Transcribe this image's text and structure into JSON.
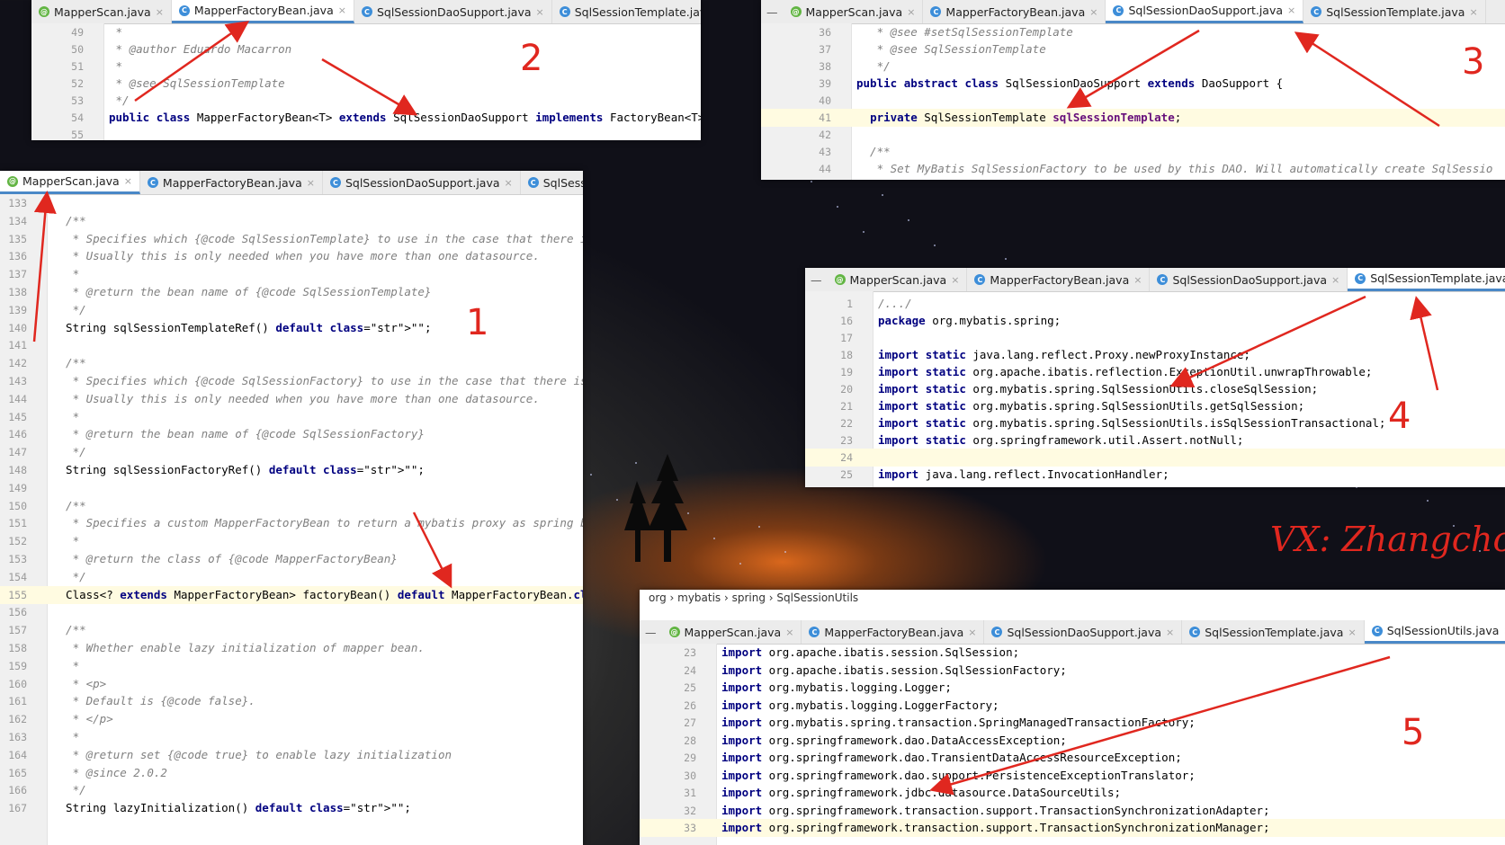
{
  "watermark": "VX:  Zhangchong",
  "colors": {
    "accent": "#4a88c7",
    "keyword": "#000080",
    "comment": "#808080",
    "arrow": "#e0271f"
  },
  "panel2": {
    "label": "2",
    "tabs": [
      {
        "name": "MapperScan.java",
        "icon": "annotation-icon"
      },
      {
        "name": "MapperFactoryBean.java",
        "icon": "class-icon",
        "active": true
      },
      {
        "name": "SqlSessionDaoSupport.java",
        "icon": "class-icon"
      },
      {
        "name": "SqlSessionTemplate.java",
        "icon": "class-icon"
      },
      {
        "name": "Sql",
        "icon": "class-icon"
      }
    ],
    "lines": [
      {
        "n": "49",
        "t": " *",
        "c": "cm"
      },
      {
        "n": "50",
        "t": " * @author Eduardo Macarron",
        "c": "cm"
      },
      {
        "n": "51",
        "t": " *",
        "c": "cm"
      },
      {
        "n": "52",
        "t": " * @see SqlSessionTemplate",
        "c": "cm"
      },
      {
        "n": "53",
        "t": " */",
        "c": "cm"
      },
      {
        "n": "54",
        "t": "public class MapperFactoryBean<T> extends SqlSessionDaoSupport implements FactoryBean<T> {",
        "c": ""
      },
      {
        "n": "55",
        "t": "",
        "c": ""
      }
    ]
  },
  "panel3": {
    "label": "3",
    "tabs": [
      {
        "name": "MapperScan.java",
        "icon": "annotation-icon"
      },
      {
        "name": "MapperFactoryBean.java",
        "icon": "class-icon"
      },
      {
        "name": "SqlSessionDaoSupport.java",
        "icon": "class-icon",
        "active": true
      },
      {
        "name": "SqlSessionTemplate.java",
        "icon": "class-icon"
      }
    ],
    "lines": [
      {
        "n": "36",
        "t": "   * @see #setSqlSessionTemplate",
        "c": "cm"
      },
      {
        "n": "37",
        "t": "   * @see SqlSessionTemplate",
        "c": "cm"
      },
      {
        "n": "38",
        "t": "   */",
        "c": "cm"
      },
      {
        "n": "39",
        "t": "public abstract class SqlSessionDaoSupport extends DaoSupport {",
        "c": ""
      },
      {
        "n": "40",
        "t": "",
        "c": ""
      },
      {
        "n": "41",
        "t": "  private SqlSessionTemplate sqlSessionTemplate;",
        "c": "",
        "hl": true
      },
      {
        "n": "42",
        "t": "",
        "c": ""
      },
      {
        "n": "43",
        "t": "  /**",
        "c": "cm"
      },
      {
        "n": "44",
        "t": "   * Set MyBatis SqlSessionFactory to be used by this DAO. Will automatically create SqlSessio",
        "c": "cm"
      }
    ]
  },
  "panel1": {
    "label": "1",
    "tabs": [
      {
        "name": "MapperScan.java",
        "icon": "annotation-icon",
        "active": true
      },
      {
        "name": "MapperFactoryBean.java",
        "icon": "class-icon"
      },
      {
        "name": "SqlSessionDaoSupport.java",
        "icon": "class-icon"
      },
      {
        "name": "SqlSessionTem",
        "icon": "class-icon"
      }
    ],
    "lines": [
      {
        "n": "133",
        "t": "",
        "c": ""
      },
      {
        "n": "134",
        "t": "  /**",
        "c": "cm"
      },
      {
        "n": "135",
        "t": "   * Specifies which {@code SqlSessionTemplate} to use in the case that there is more",
        "c": "cm"
      },
      {
        "n": "136",
        "t": "   * Usually this is only needed when you have more than one datasource.",
        "c": "cm"
      },
      {
        "n": "137",
        "t": "   *",
        "c": "cm"
      },
      {
        "n": "138",
        "t": "   * @return the bean name of {@code SqlSessionTemplate}",
        "c": "cm"
      },
      {
        "n": "139",
        "t": "   */",
        "c": "cm"
      },
      {
        "n": "140",
        "t": "  String sqlSessionTemplateRef() default \"\";",
        "c": ""
      },
      {
        "n": "141",
        "t": "",
        "c": ""
      },
      {
        "n": "142",
        "t": "  /**",
        "c": "cm"
      },
      {
        "n": "143",
        "t": "   * Specifies which {@code SqlSessionFactory} to use in the case that there is more",
        "c": "cm"
      },
      {
        "n": "144",
        "t": "   * Usually this is only needed when you have more than one datasource.",
        "c": "cm"
      },
      {
        "n": "145",
        "t": "   *",
        "c": "cm"
      },
      {
        "n": "146",
        "t": "   * @return the bean name of {@code SqlSessionFactory}",
        "c": "cm"
      },
      {
        "n": "147",
        "t": "   */",
        "c": "cm"
      },
      {
        "n": "148",
        "t": "  String sqlSessionFactoryRef() default \"\";",
        "c": ""
      },
      {
        "n": "149",
        "t": "",
        "c": ""
      },
      {
        "n": "150",
        "t": "  /**",
        "c": "cm"
      },
      {
        "n": "151",
        "t": "   * Specifies a custom MapperFactoryBean to return a mybatis proxy as spring bean.",
        "c": "cm"
      },
      {
        "n": "152",
        "t": "   *",
        "c": "cm"
      },
      {
        "n": "153",
        "t": "   * @return the class of {@code MapperFactoryBean}",
        "c": "cm"
      },
      {
        "n": "154",
        "t": "   */",
        "c": "cm"
      },
      {
        "n": "155",
        "t": "  Class<? extends MapperFactoryBean> factoryBean() default MapperFactoryBean.class;",
        "c": "",
        "hl": true
      },
      {
        "n": "156",
        "t": "",
        "c": ""
      },
      {
        "n": "157",
        "t": "  /**",
        "c": "cm"
      },
      {
        "n": "158",
        "t": "   * Whether enable lazy initialization of mapper bean.",
        "c": "cm"
      },
      {
        "n": "159",
        "t": "   *",
        "c": "cm"
      },
      {
        "n": "160",
        "t": "   * <p>",
        "c": "cm"
      },
      {
        "n": "161",
        "t": "   * Default is {@code false}.",
        "c": "cm"
      },
      {
        "n": "162",
        "t": "   * </p>",
        "c": "cm"
      },
      {
        "n": "163",
        "t": "   *",
        "c": "cm"
      },
      {
        "n": "164",
        "t": "   * @return set {@code true} to enable lazy initialization",
        "c": "cm"
      },
      {
        "n": "165",
        "t": "   * @since 2.0.2",
        "c": "cm"
      },
      {
        "n": "166",
        "t": "   */",
        "c": "cm"
      },
      {
        "n": "167",
        "t": "  String lazyInitialization() default \"\";",
        "c": ""
      }
    ]
  },
  "panel4": {
    "label": "4",
    "tabs": [
      {
        "name": "MapperScan.java",
        "icon": "annotation-icon"
      },
      {
        "name": "MapperFactoryBean.java",
        "icon": "class-icon"
      },
      {
        "name": "SqlSessionDaoSupport.java",
        "icon": "class-icon"
      },
      {
        "name": "SqlSessionTemplate.java",
        "icon": "class-icon",
        "active": true
      }
    ],
    "lines": [
      {
        "n": "1",
        "t": "/.../",
        "c": "cm"
      },
      {
        "n": "16",
        "t": "package org.mybatis.spring;",
        "c": ""
      },
      {
        "n": "17",
        "t": "",
        "c": ""
      },
      {
        "n": "18",
        "t": "import static java.lang.reflect.Proxy.newProxyInstance;",
        "c": ""
      },
      {
        "n": "19",
        "t": "import static org.apache.ibatis.reflection.ExceptionUtil.unwrapThrowable;",
        "c": ""
      },
      {
        "n": "20",
        "t": "import static org.mybatis.spring.SqlSessionUtils.closeSqlSession;",
        "c": ""
      },
      {
        "n": "21",
        "t": "import static org.mybatis.spring.SqlSessionUtils.getSqlSession;",
        "c": ""
      },
      {
        "n": "22",
        "t": "import static org.mybatis.spring.SqlSessionUtils.isSqlSessionTransactional;",
        "c": ""
      },
      {
        "n": "23",
        "t": "import static org.springframework.util.Assert.notNull;",
        "c": ""
      },
      {
        "n": "24",
        "t": "",
        "c": "",
        "hl": true
      },
      {
        "n": "25",
        "t": "import java.lang.reflect.InvocationHandler;",
        "c": ""
      }
    ]
  },
  "panel5": {
    "label": "5",
    "breadcrumb": [
      "org",
      "mybatis",
      "spring",
      "SqlSessionUtils"
    ],
    "tabs": [
      {
        "name": "MapperScan.java",
        "icon": "annotation-icon"
      },
      {
        "name": "MapperFactoryBean.java",
        "icon": "class-icon"
      },
      {
        "name": "SqlSessionDaoSupport.java",
        "icon": "class-icon"
      },
      {
        "name": "SqlSessionTemplate.java",
        "icon": "class-icon"
      },
      {
        "name": "SqlSessionUtils.java",
        "icon": "class-icon",
        "active": true
      }
    ],
    "lines": [
      {
        "n": "23",
        "t": "import org.apache.ibatis.session.SqlSession;",
        "c": ""
      },
      {
        "n": "24",
        "t": "import org.apache.ibatis.session.SqlSessionFactory;",
        "c": ""
      },
      {
        "n": "25",
        "t": "import org.mybatis.logging.Logger;",
        "c": ""
      },
      {
        "n": "26",
        "t": "import org.mybatis.logging.LoggerFactory;",
        "c": ""
      },
      {
        "n": "27",
        "t": "import org.mybatis.spring.transaction.SpringManagedTransactionFactory;",
        "c": ""
      },
      {
        "n": "28",
        "t": "import org.springframework.dao.DataAccessException;",
        "c": ""
      },
      {
        "n": "29",
        "t": "import org.springframework.dao.TransientDataAccessResourceException;",
        "c": ""
      },
      {
        "n": "30",
        "t": "import org.springframework.dao.support.PersistenceExceptionTranslator;",
        "c": ""
      },
      {
        "n": "31",
        "t": "import org.springframework.jdbc.datasource.DataSourceUtils;",
        "c": ""
      },
      {
        "n": "32",
        "t": "import org.springframework.transaction.support.TransactionSynchronizationAdapter;",
        "c": ""
      },
      {
        "n": "33",
        "t": "import org.springframework.transaction.support.TransactionSynchronizationManager;",
        "c": "",
        "hl": true
      }
    ]
  }
}
